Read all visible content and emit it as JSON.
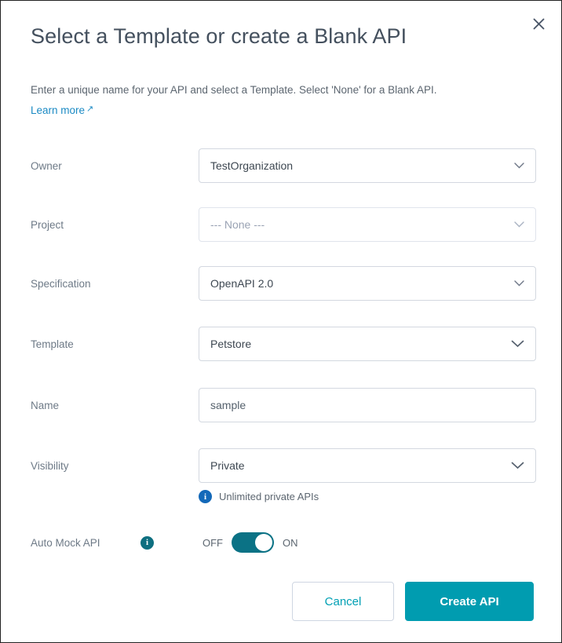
{
  "dialog": {
    "title": "Select a Template or create a Blank API",
    "description": "Enter a unique name for your API and select a Template. Select 'None' for a Blank API.",
    "learn_more": "Learn more",
    "learn_more_arrow": "↗",
    "close_icon": "close-icon"
  },
  "fields": [
    {
      "label": "Owner",
      "value": "TestOrganization",
      "type": "select",
      "disabled": false
    },
    {
      "label": "Project",
      "value": "--- None ---",
      "type": "select",
      "disabled": true
    },
    {
      "label": "Specification",
      "value": "OpenAPI 2.0",
      "type": "select",
      "disabled": false
    },
    {
      "label": "Template",
      "value": "Petstore",
      "type": "select",
      "disabled": false
    },
    {
      "label": "Name",
      "value": "sample",
      "type": "text",
      "disabled": false
    },
    {
      "label": "Visibility",
      "value": "Private",
      "type": "select",
      "disabled": false
    }
  ],
  "hint": {
    "icon": "info-icon",
    "text": "Unlimited private APIs"
  },
  "auto_mock": {
    "label": "Auto Mock API",
    "icon": "info-icon",
    "off_label": "OFF",
    "on_label": "ON",
    "state": "ON"
  },
  "footer": {
    "cancel_label": "Cancel",
    "create_label": "Create API"
  },
  "colors": {
    "accent_teal": "#009cb0",
    "toggle_on": "#0b7285",
    "link_blue": "#1b8ac4",
    "info_blue": "#1469b9",
    "label_gray": "#6e7a87",
    "title_gray": "#44505e"
  }
}
